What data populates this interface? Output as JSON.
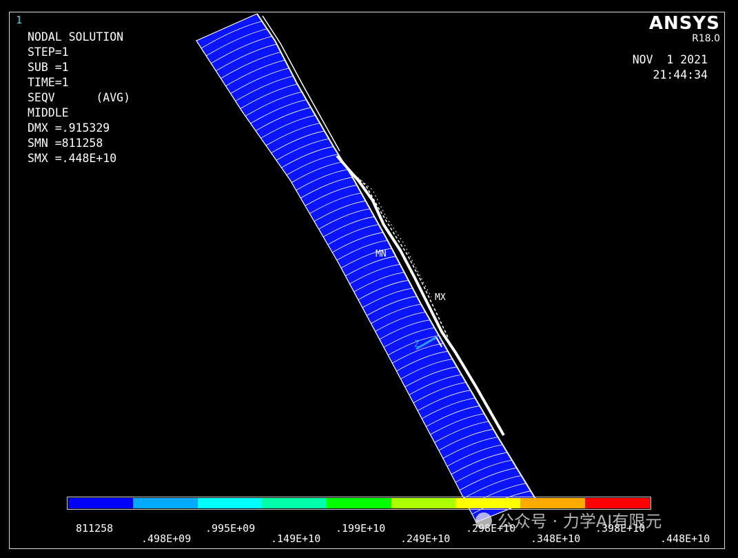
{
  "window": {
    "number": "1"
  },
  "info": [
    "NODAL SOLUTION",
    "",
    "STEP=1",
    "SUB =1",
    "TIME=1",
    "SEQV      (AVG)",
    "MIDDLE",
    "DMX =.915329",
    "SMN =811258",
    "SMX =.448E+10"
  ],
  "logo": {
    "brand": "ANSYS",
    "version": "R18.0"
  },
  "datetime": {
    "date": "NOV  1 2021",
    "time": "21:44:34"
  },
  "markers": {
    "min": "MN",
    "max": "MX",
    "axis_z": "Z"
  },
  "colors": {
    "model_fill": "#0a14ff",
    "mesh_line": "#ffffff",
    "text": "#ffffff",
    "window_number": "#4fd0e0"
  },
  "legend": {
    "colors": [
      "#0000ff",
      "#00aaff",
      "#00ffff",
      "#00ffaa",
      "#00ff00",
      "#aaff00",
      "#ffff00",
      "#ffaa00",
      "#ff0000"
    ],
    "labels_top": [
      "811258",
      ".995E+09",
      ".199E+10",
      ".298E+10"
    ],
    "labels_bottom": [
      ".498E+09",
      ".149E+10",
      ".249E+10",
      ".348E+10",
      ".448E+10"
    ],
    "label_398": ".398E+10"
  },
  "watermark": {
    "text": "公众号 · 力学AI有限元"
  }
}
